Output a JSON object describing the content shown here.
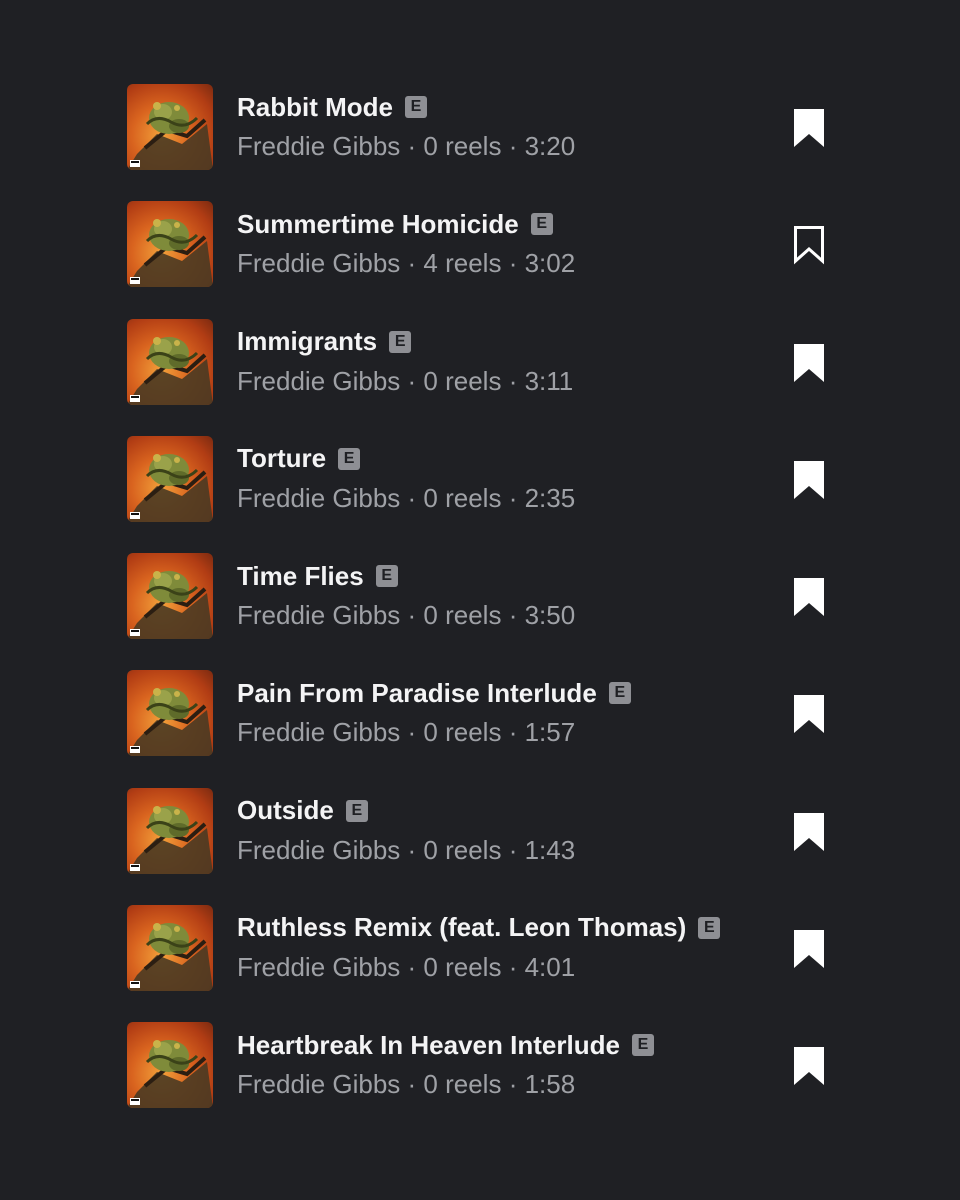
{
  "tracks": [
    {
      "title": "Rabbit Mode",
      "explicit": "E",
      "artist": "Freddie Gibbs",
      "reels": "0 reels",
      "duration": "3:20",
      "saved": true
    },
    {
      "title": "Summertime Homicide",
      "explicit": "E",
      "artist": "Freddie Gibbs",
      "reels": "4 reels",
      "duration": "3:02",
      "saved": false
    },
    {
      "title": "Immigrants",
      "explicit": "E",
      "artist": "Freddie Gibbs",
      "reels": "0 reels",
      "duration": "3:11",
      "saved": true
    },
    {
      "title": "Torture",
      "explicit": "E",
      "artist": "Freddie Gibbs",
      "reels": "0 reels",
      "duration": "2:35",
      "saved": true
    },
    {
      "title": "Time Flies",
      "explicit": "E",
      "artist": "Freddie Gibbs",
      "reels": "0 reels",
      "duration": "3:50",
      "saved": true
    },
    {
      "title": "Pain From Paradise Interlude",
      "explicit": "E",
      "artist": "Freddie Gibbs",
      "reels": "0 reels",
      "duration": "1:57",
      "saved": true
    },
    {
      "title": "Outside",
      "explicit": "E",
      "artist": "Freddie Gibbs",
      "reels": "0 reels",
      "duration": "1:43",
      "saved": true
    },
    {
      "title": "Ruthless Remix (feat. Leon Thomas)",
      "explicit": "E",
      "artist": "Freddie Gibbs",
      "reels": "0 reels",
      "duration": "4:01",
      "saved": true
    },
    {
      "title": "Heartbreak In Heaven Interlude",
      "explicit": "E",
      "artist": "Freddie Gibbs",
      "reels": "0 reels",
      "duration": "1:58",
      "saved": true
    }
  ],
  "separator": " · ",
  "icons": {
    "save_filled": "bookmark-filled-icon",
    "save_outline": "bookmark-outline-icon",
    "cover": "album-cover-art"
  },
  "colors": {
    "background": "#1f2024",
    "title": "#f4f4f5",
    "subtitle": "#9fa1a6",
    "explicit_badge": "#8e8f94",
    "bookmark": "#ffffff"
  }
}
